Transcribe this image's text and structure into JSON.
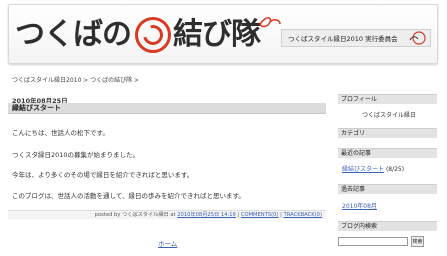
{
  "header": {
    "logo_left": "つくばの",
    "logo_right": "結び隊",
    "committee": "つくばスタイル縁日2010 実行委員会"
  },
  "breadcrumb": "つくばスタイル縁日2010 > つくばの結び隊 >",
  "post": {
    "date": "2010年08月25日",
    "title": "縁結びスタート",
    "paragraphs": [
      "こんにちは、世話人の松下です。",
      "つくスタ縁日2010の募集が始まりました。",
      "今年は、より多くのその場で縁日を紹介できればと思います。",
      "このブログは、世話人の活動を通して、縁日の歩みを紹介できればと思います。"
    ],
    "footer_prefix": "posted by つくばスタイル縁日 at",
    "footer_time": "2010年08月25日 14:19",
    "footer_comments": "COMMENTS(0)",
    "footer_trackback": "TRACKBACK(0)",
    "sep": "|"
  },
  "nav": {
    "home": "ホーム"
  },
  "sidebar": {
    "profile_head": "プロフィール",
    "profile_name": "つくばスタイル縁日",
    "category_head": "カテゴリ",
    "recent_head": "最近の記事",
    "recent_link": "縁結びスタート",
    "recent_count": "(8/25)",
    "archive_head": "過去記事",
    "archive_link": "2010年08月",
    "search_head": "ブログ内検索",
    "search_value": "",
    "search_button": "検索"
  },
  "colors": {
    "accent_red": "#d83a22",
    "link_blue": "#3b63b6"
  }
}
